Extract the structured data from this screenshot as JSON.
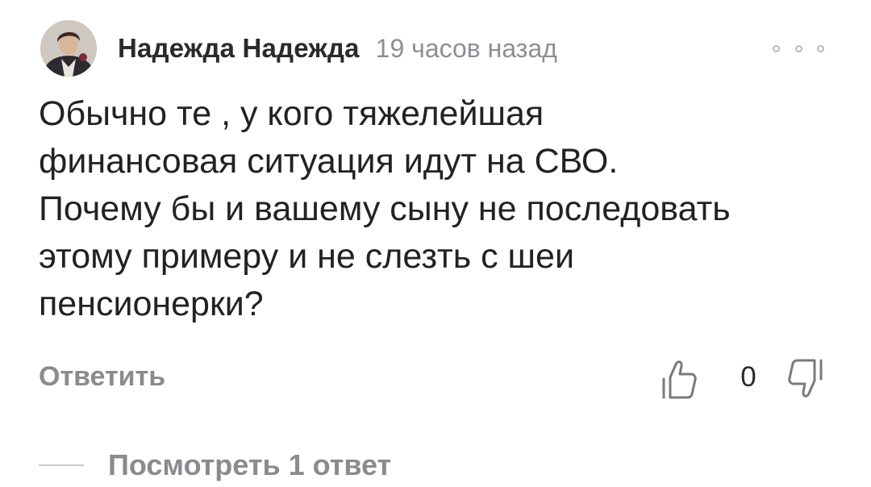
{
  "comment": {
    "author": "Надежда Надежда",
    "time": "19 часов назад",
    "text": "Обычно те , у кого тяжелейшая\nфинансовая ситуация идут на СВО.\nПочему бы и вашему сыну не последовать\nэтому примеру и не слезть с шеи\nпенсионерки?",
    "reply_label": "Ответить",
    "likes_count": "0",
    "view_replies_label": "Посмотреть 1 ответ"
  },
  "icons": {
    "more": "more-dots-icon",
    "like": "thumb-up-icon",
    "dislike": "thumb-down-icon"
  },
  "colors": {
    "text": "#222222",
    "muted": "#8b8b8f",
    "icon": "#7a7a7e"
  }
}
